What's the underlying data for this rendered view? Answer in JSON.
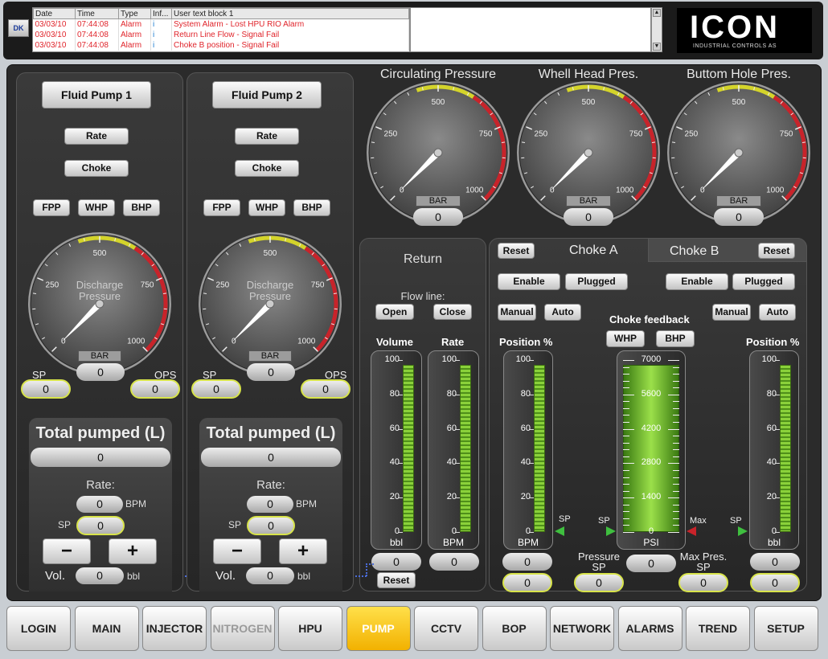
{
  "alarms": {
    "headers": [
      "Date",
      "Time",
      "Type",
      "Inf...",
      "User text block 1"
    ],
    "rows": [
      [
        "03/03/10",
        "07:44:08",
        "Alarm",
        "i",
        "System Alarm - Lost HPU RIO Alarm"
      ],
      [
        "03/03/10",
        "07:44:08",
        "Alarm",
        "i",
        "Return Line Flow - Signal Fail"
      ],
      [
        "03/03/10",
        "07:44:08",
        "Alarm",
        "i",
        "Choke B position - Signal Fail"
      ]
    ],
    "ack_label": "DK"
  },
  "logo": {
    "name": "ICON",
    "tagline": "INDUSTRIAL CONTROLS AS"
  },
  "pumps": [
    {
      "title": "Fluid Pump 1",
      "rate": "Rate",
      "choke": "Choke",
      "fpp": "FPP",
      "whp": "WHP",
      "bhp": "BHP",
      "gauge_label_1": "Discharge",
      "gauge_label_2": "Pressure",
      "unit": "BAR",
      "value": "0",
      "sp_label": "SP",
      "sp_value": "0",
      "ops_label": "OPS",
      "ops_value": "0",
      "total_title": "Total pumped (L)",
      "total_value": "0",
      "rate_label": "Rate:",
      "rate_value": "0",
      "rate_unit": "BPM",
      "rate_sp_label": "SP",
      "rate_sp_value": "0",
      "minus": "−",
      "plus": "+",
      "vol_label": "Vol.",
      "vol_value": "0",
      "vol_unit": "bbl"
    },
    {
      "title": "Fluid Pump 2",
      "rate": "Rate",
      "choke": "Choke",
      "fpp": "FPP",
      "whp": "WHP",
      "bhp": "BHP",
      "gauge_label_1": "Discharge",
      "gauge_label_2": "Pressure",
      "unit": "BAR",
      "value": "0",
      "sp_label": "SP",
      "sp_value": "0",
      "ops_label": "OPS",
      "ops_value": "0",
      "total_title": "Total pumped (L)",
      "total_value": "0",
      "rate_label": "Rate:",
      "rate_value": "0",
      "rate_unit": "BPM",
      "rate_sp_label": "SP",
      "rate_sp_value": "0",
      "minus": "−",
      "plus": "+",
      "vol_label": "Vol.",
      "vol_value": "0",
      "vol_unit": "bbl"
    }
  ],
  "gauge_ticks": [
    "0",
    "250",
    "500",
    "750",
    "1000"
  ],
  "pressures": [
    {
      "title": "Circulating Pressure",
      "unit": "BAR",
      "value": "0"
    },
    {
      "title": "Whell Head Pres.",
      "unit": "BAR",
      "value": "0"
    },
    {
      "title": "Buttom Hole Pres.",
      "unit": "BAR",
      "value": "0"
    }
  ],
  "return": {
    "title": "Return",
    "flowline": "Flow line:",
    "open": "Open",
    "close": "Close",
    "volume_label": "Volume",
    "rate_label": "Rate",
    "volume_unit": "bbl",
    "rate_unit": "BPM",
    "volume_value": "0",
    "rate_value": "0",
    "reset": "Reset",
    "volume_level": 0.97,
    "rate_level": 0.97
  },
  "scale_100": [
    "100",
    "80",
    "60",
    "40",
    "20",
    "0"
  ],
  "scale_psi": [
    "7000",
    "5600",
    "4200",
    "2800",
    "1400",
    "0"
  ],
  "chokeA": {
    "reset": "Reset",
    "title": "Choke A",
    "enable": "Enable",
    "plugged": "Plugged",
    "manual": "Manual",
    "auto": "Auto",
    "position_label": "Position %",
    "unit": "BPM",
    "sp_marker": "SP",
    "value": "0",
    "sp_value": "0",
    "level": 0.97
  },
  "chokeB": {
    "reset": "Reset",
    "title": "Choke B",
    "enable": "Enable",
    "plugged": "Plugged",
    "manual": "Manual",
    "auto": "Auto",
    "position_label": "Position %",
    "unit": "bbl",
    "sp_marker": "SP",
    "value": "0",
    "sp_value": "0",
    "level": 0.97
  },
  "feedback": {
    "title": "Choke feedback",
    "whp": "WHP",
    "bhp": "BHP",
    "unit": "PSI",
    "sp_marker": "SP",
    "max_marker": "Max",
    "pressure_sp_label_1": "Pressure",
    "pressure_sp_label_2": "SP",
    "max_pres_label_1": "Max Pres.",
    "max_pres_label_2": "SP",
    "value": "0",
    "pressure_sp_value": "0",
    "max_pres_value": "0",
    "level": 0.97
  },
  "nav": [
    {
      "label": "LOGIN",
      "state": "normal"
    },
    {
      "label": "MAIN",
      "state": "normal"
    },
    {
      "label": "INJECTOR",
      "state": "normal"
    },
    {
      "label": "NITROGEN",
      "state": "disabled"
    },
    {
      "label": "HPU",
      "state": "normal"
    },
    {
      "label": "PUMP",
      "state": "active"
    },
    {
      "label": "CCTV",
      "state": "normal"
    },
    {
      "label": "BOP",
      "state": "normal"
    },
    {
      "label": "NETWORK",
      "state": "normal"
    },
    {
      "label": "ALARMS",
      "state": "normal"
    },
    {
      "label": "TREND",
      "state": "normal"
    },
    {
      "label": "SETUP",
      "state": "normal"
    }
  ],
  "colors": {
    "accent_active": "#f2b100",
    "alarm_text": "#e0242b",
    "sp_border": "#d8e44a",
    "bar_green": "#8ad13a",
    "gauge_red": "#c8232a",
    "gauge_yellow": "#d4d42a"
  }
}
